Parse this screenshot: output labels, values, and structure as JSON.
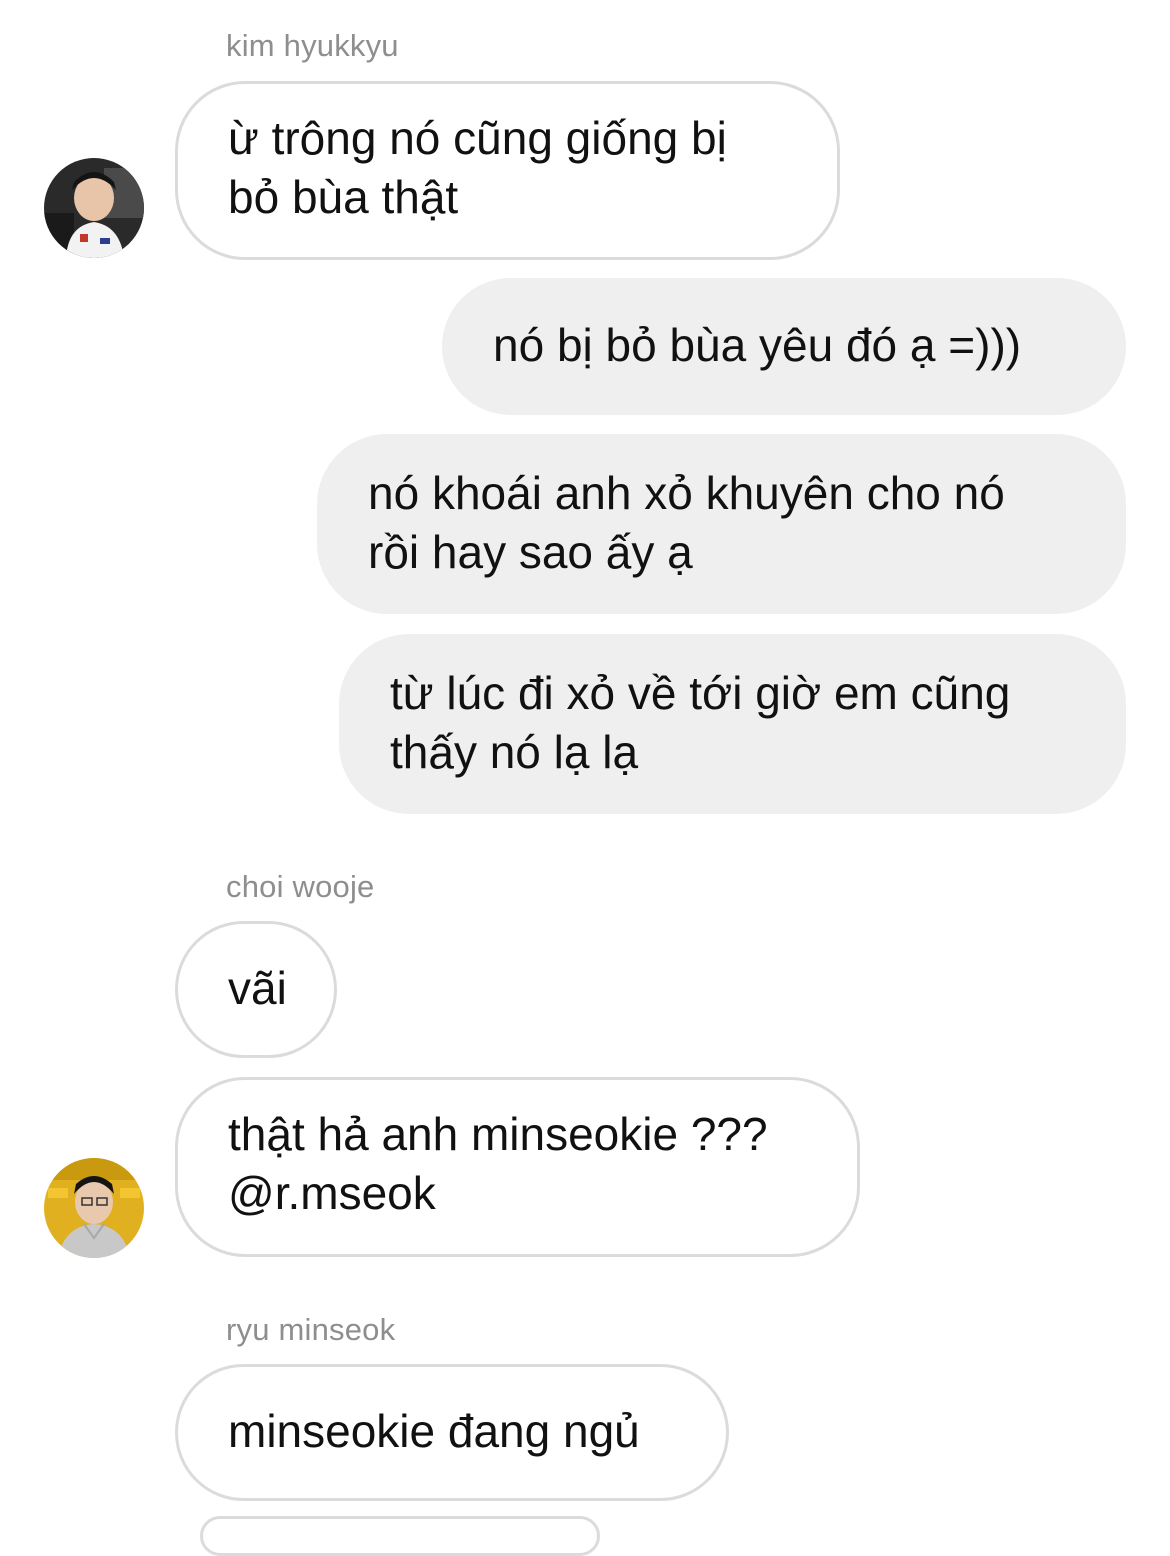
{
  "thread": {
    "messages": [
      {
        "id": "m1",
        "direction": "incoming",
        "sender": "kim hyukkyu",
        "text": "ừ trông nó cũng giống bị\nbỏ bùa thật"
      },
      {
        "id": "m2",
        "direction": "outgoing",
        "text": "nó bị bỏ bùa yêu đó ạ =)))"
      },
      {
        "id": "m3",
        "direction": "outgoing",
        "text": "nó khoái anh xỏ khuyên cho nó\nrồi hay sao ấy ạ"
      },
      {
        "id": "m4",
        "direction": "outgoing",
        "text": "từ lúc đi xỏ về tới giờ em cũng\nthấy nó lạ lạ"
      },
      {
        "id": "m5",
        "direction": "incoming",
        "sender": "choi wooje",
        "text": "vãi"
      },
      {
        "id": "m6",
        "direction": "incoming",
        "text": "thật hả anh minseokie ???\n@r.mseok"
      },
      {
        "id": "m7",
        "direction": "incoming",
        "sender": "ryu minseok",
        "text": "minseokie đang ngủ"
      }
    ]
  },
  "colors": {
    "incoming_border": "#dbdbdb",
    "outgoing_background": "#efefef",
    "sender_name": "#8e8e8e"
  }
}
